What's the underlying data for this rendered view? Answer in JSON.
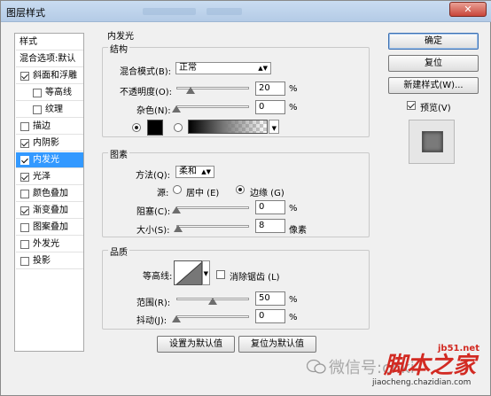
{
  "window": {
    "title": "图层样式"
  },
  "sidebar": {
    "items": [
      {
        "label": "样式",
        "checkbox": false,
        "checked": false,
        "selected": false,
        "indent": 0
      },
      {
        "label": "混合选项:默认",
        "checkbox": false,
        "checked": false,
        "selected": false,
        "indent": 0
      },
      {
        "label": "斜面和浮雕",
        "checkbox": true,
        "checked": true,
        "selected": false,
        "indent": 0
      },
      {
        "label": "等高线",
        "checkbox": true,
        "checked": false,
        "selected": false,
        "indent": 1
      },
      {
        "label": "纹理",
        "checkbox": true,
        "checked": false,
        "selected": false,
        "indent": 1
      },
      {
        "label": "描边",
        "checkbox": true,
        "checked": false,
        "selected": false,
        "indent": 0
      },
      {
        "label": "内阴影",
        "checkbox": true,
        "checked": true,
        "selected": false,
        "indent": 0
      },
      {
        "label": "内发光",
        "checkbox": true,
        "checked": true,
        "selected": true,
        "indent": 0
      },
      {
        "label": "光泽",
        "checkbox": true,
        "checked": true,
        "selected": false,
        "indent": 0
      },
      {
        "label": "颜色叠加",
        "checkbox": true,
        "checked": false,
        "selected": false,
        "indent": 0
      },
      {
        "label": "渐变叠加",
        "checkbox": true,
        "checked": true,
        "selected": false,
        "indent": 0
      },
      {
        "label": "图案叠加",
        "checkbox": true,
        "checked": false,
        "selected": false,
        "indent": 0
      },
      {
        "label": "外发光",
        "checkbox": true,
        "checked": false,
        "selected": false,
        "indent": 0
      },
      {
        "label": "投影",
        "checkbox": true,
        "checked": false,
        "selected": false,
        "indent": 0
      }
    ]
  },
  "panel": {
    "title": "内发光",
    "structure": {
      "legend": "结构",
      "blend_mode_label": "混合模式(B):",
      "blend_mode_value": "正常",
      "opacity_label": "不透明度(O):",
      "opacity_value": "20",
      "opacity_unit": "%",
      "opacity_level": 20,
      "noise_label": "杂色(N):",
      "noise_value": "0",
      "noise_unit": "%",
      "noise_level": 0,
      "color_swatch": "#000000",
      "color_mode": "color"
    },
    "elements": {
      "legend": "图素",
      "method_label": "方法(Q):",
      "method_value": "柔和",
      "source_label": "源:",
      "source_center_label": "居中 (E)",
      "source_edge_label": "边缘 (G)",
      "source_value": "edge",
      "choke_label": "阻塞(C):",
      "choke_value": "0",
      "choke_unit": "%",
      "choke_level": 0,
      "size_label": "大小(S):",
      "size_value": "8",
      "size_unit": "像素",
      "size_level": 3
    },
    "quality": {
      "legend": "品质",
      "contour_label": "等高线:",
      "anti_alias_label": "消除锯齿 (L)",
      "anti_alias_checked": false,
      "range_label": "范围(R):",
      "range_value": "50",
      "range_unit": "%",
      "range_level": 50,
      "jitter_label": "抖动(J):",
      "jitter_value": "0",
      "jitter_unit": "%",
      "jitter_level": 0
    },
    "make_default_label": "设置为默认值",
    "reset_default_label": "复位为默认值"
  },
  "actions": {
    "ok_label": "确定",
    "reset_label": "复位",
    "new_style_label": "新建样式(W)...",
    "preview_label": "预览(V)",
    "preview_checked": true
  },
  "watermark": {
    "wechat_text": "微信号:cnki",
    "site_text": "脚本之家",
    "site_url": "jb51.net",
    "site_url2": "jiaocheng.chazidian.com"
  },
  "colors": {
    "accent": "#3399ff",
    "watermark_red": "#d22a22"
  }
}
